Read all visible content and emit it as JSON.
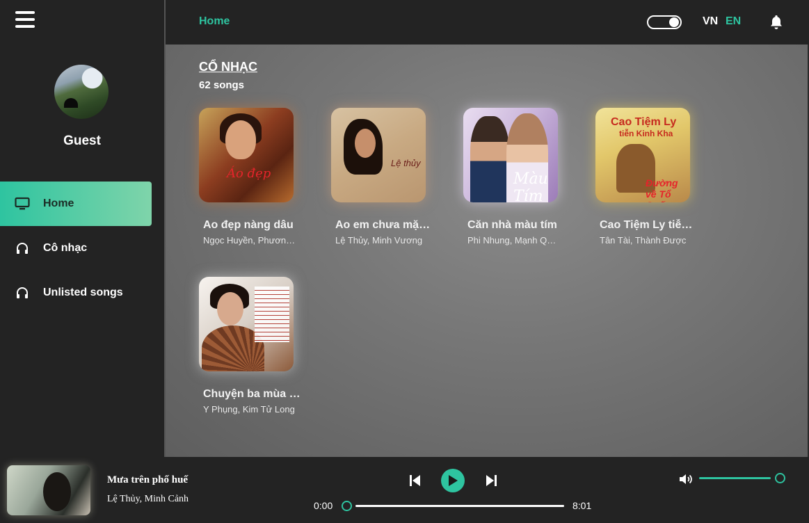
{
  "sidebar": {
    "menu_icon": "hamburger-icon",
    "user_name": "Guest",
    "items": [
      {
        "label": "Home",
        "icon": "monitor-icon",
        "active": true
      },
      {
        "label": "Cô nhạc",
        "icon": "headphones-icon",
        "active": false
      },
      {
        "label": "Unlisted songs",
        "icon": "headphones-icon",
        "active": false
      }
    ]
  },
  "header": {
    "breadcrumb": "Home",
    "languages": [
      "VN",
      "EN"
    ],
    "active_language": "EN",
    "theme_toggle": "on"
  },
  "playlist": {
    "title": "CỔ NHẠC",
    "count": "62 songs",
    "songs": [
      {
        "title": "Ao đẹp nàng dâu",
        "artists": "Ngọc Huyền, Phương Lan"
      },
      {
        "title": "Ao em chưa mặc một lần",
        "artists": "Lệ Thủy, Minh Vương"
      },
      {
        "title": "Căn nhà màu tím",
        "artists": "Phi Nhung, Mạnh Quỳnh"
      },
      {
        "title": "Cao Tiệm Ly tiễn Kinh Kha",
        "artists": "Tân Tài, Thành Được"
      },
      {
        "title": "Chuyện ba mùa mưa",
        "artists": "Y Phụng, Kim Tử Long"
      }
    ],
    "cover_texts": {
      "c1": "Áo đẹp",
      "c2": "Lệ thủy",
      "c3": "Màu Tím",
      "c4_a": "Cao Tiệm Ly",
      "c4_b": "tiễn Kinh Kha",
      "c4_c": "Đường về Tổ Quốc"
    }
  },
  "player": {
    "title": "Mưa trên phố huế",
    "artist": "Lệ Thủy, Minh Cảnh",
    "current_time": "0:00",
    "duration": "8:01",
    "progress": 0,
    "volume": 0.92,
    "accent": "#2ec4a0"
  }
}
